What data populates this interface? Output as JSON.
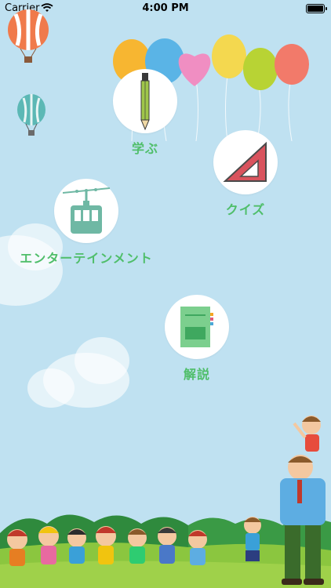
{
  "status_bar": {
    "carrier": "Carrier",
    "time": "4:00 PM"
  },
  "menu": {
    "learn": {
      "label": "学ぶ",
      "icon": "pencil-icon"
    },
    "quiz": {
      "label": "クイズ",
      "icon": "triangle-ruler-icon"
    },
    "entertainment": {
      "label": "エンターテインメント",
      "icon": "gondola-icon"
    },
    "explanation": {
      "label": "解説",
      "icon": "notebook-icon"
    }
  },
  "colors": {
    "background": "#bfe1f1",
    "label": "#4fbe6a"
  }
}
